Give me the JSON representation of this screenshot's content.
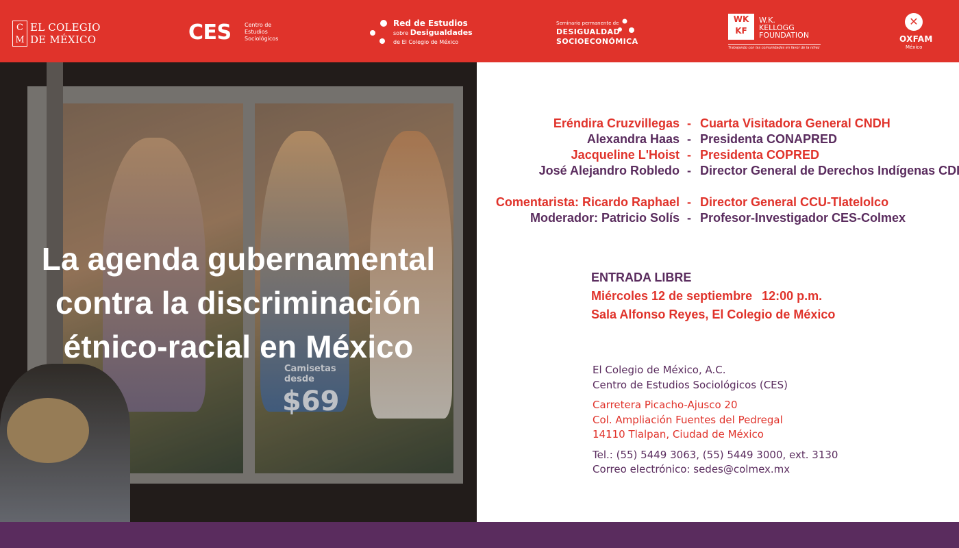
{
  "header": {
    "colmex": {
      "mark_top": "C",
      "mark_bottom": "M",
      "line1": "EL COLEGIO",
      "line2": "DE MÉXICO"
    },
    "ces": {
      "acronym": "CES",
      "line1": "Centro de",
      "line2": "Estudios",
      "line3": "Sociológicos"
    },
    "red_estudios": {
      "line1": "Red de Estudios",
      "line2_small": "sobre",
      "line2_big": "Desigualdades",
      "line3": "de El Colegio de México"
    },
    "seminario": {
      "small": "Seminario permanente de",
      "line1": "DESIGUALDAD",
      "line2": "SOCIOECONÓMICA"
    },
    "kellogg": {
      "mark_top": "WK",
      "mark_bottom": "KF",
      "line1": "W.K.",
      "line2": "KELLOGG",
      "line3": "FOUNDATION",
      "tagline": "Trabajando con las comunidades en favor de la niñez"
    },
    "oxfam": {
      "name": "OXFAM",
      "country": "México"
    }
  },
  "photo": {
    "shirt_line1": "Camisetas",
    "shirt_line2": "desde",
    "shirt_price": "$69"
  },
  "event": {
    "title_lines": [
      "La agenda gubernamental",
      "contra la discriminación",
      "étnico-racial en México"
    ]
  },
  "speakers": [
    {
      "name": "Eréndira Cruzvillegas",
      "role": "Cuarta Visitadora General CNDH",
      "color": "#e0332b"
    },
    {
      "name": "Alexandra Haas",
      "role": "Presidenta CONAPRED",
      "color": "#5a2c5e"
    },
    {
      "name": "Jacqueline L'Hoist",
      "role": "Presidenta COPRED",
      "color": "#e0332b"
    },
    {
      "name": "José Alejandro Robledo",
      "role": "Director General de Derechos Indígenas CDI",
      "color": "#5a2c5e"
    }
  ],
  "discussants": [
    {
      "name": "Comentarista: Ricardo Raphael",
      "role": "Director General CCU-Tlatelolco",
      "color": "#e0332b"
    },
    {
      "name": "Moderador: Patricio Solís",
      "role": "Profesor-Investigador CES-Colmex",
      "color": "#5a2c5e"
    }
  ],
  "separator": "-",
  "details": {
    "entry": "ENTRADA LIBRE",
    "date": "Miércoles 12 de septiembre",
    "time": "12:00 p.m.",
    "venue": "Sala Alfonso Reyes, El Colegio de México"
  },
  "contact": {
    "org1": "El Colegio de México, A.C.",
    "org2": "Centro de Estudios Sociológicos (CES)",
    "addr1": "Carretera Picacho-Ajusco 20",
    "addr2": "Col. Ampliación Fuentes del Pedregal",
    "addr3": "14110 Tlalpan, Ciudad de México",
    "phone": "Tel.: (55) 5449 3063, (55) 5449 3000, ext. 3130",
    "email": "Correo electrónico: sedes@colmex.mx"
  },
  "colors": {
    "header_red": "#e0332b",
    "accent_purple": "#5a2c5e",
    "address_red": "#e0332b"
  }
}
